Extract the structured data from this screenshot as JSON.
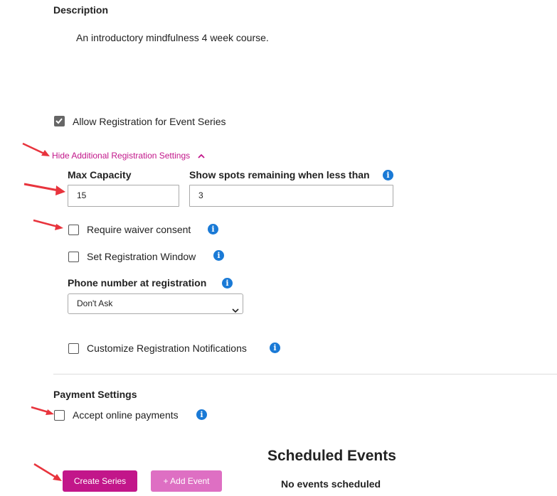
{
  "description": {
    "heading": "Description",
    "text": "An introductory mindfulness 4 week course."
  },
  "registration": {
    "allow_label": "Allow Registration for Event Series",
    "allow_checked": true,
    "toggle_label": "Hide Additional Registration Settings",
    "max_capacity_label": "Max Capacity",
    "max_capacity_value": "15",
    "spots_label": "Show spots remaining when less than",
    "spots_value": "3",
    "waiver_label": "Require waiver consent",
    "window_label": "Set Registration Window",
    "phone_label": "Phone number at registration",
    "phone_value": "Don't Ask",
    "notifications_label": "Customize Registration Notifications"
  },
  "payment": {
    "heading": "Payment Settings",
    "accept_label": "Accept online payments"
  },
  "buttons": {
    "create_series": "Create Series",
    "add_event": "+ Add Event"
  },
  "scheduled": {
    "heading": "Scheduled Events",
    "empty": "No events scheduled"
  },
  "colors": {
    "accent_magenta": "#c2168a",
    "add_event_pink": "#de6fc3",
    "info_blue": "#1a7ad6",
    "annotation_red": "#e8343d"
  },
  "icons": [
    "check-icon",
    "chevron-up-icon",
    "info-icon",
    "chevron-down-icon",
    "annotation-arrow-icon"
  ]
}
